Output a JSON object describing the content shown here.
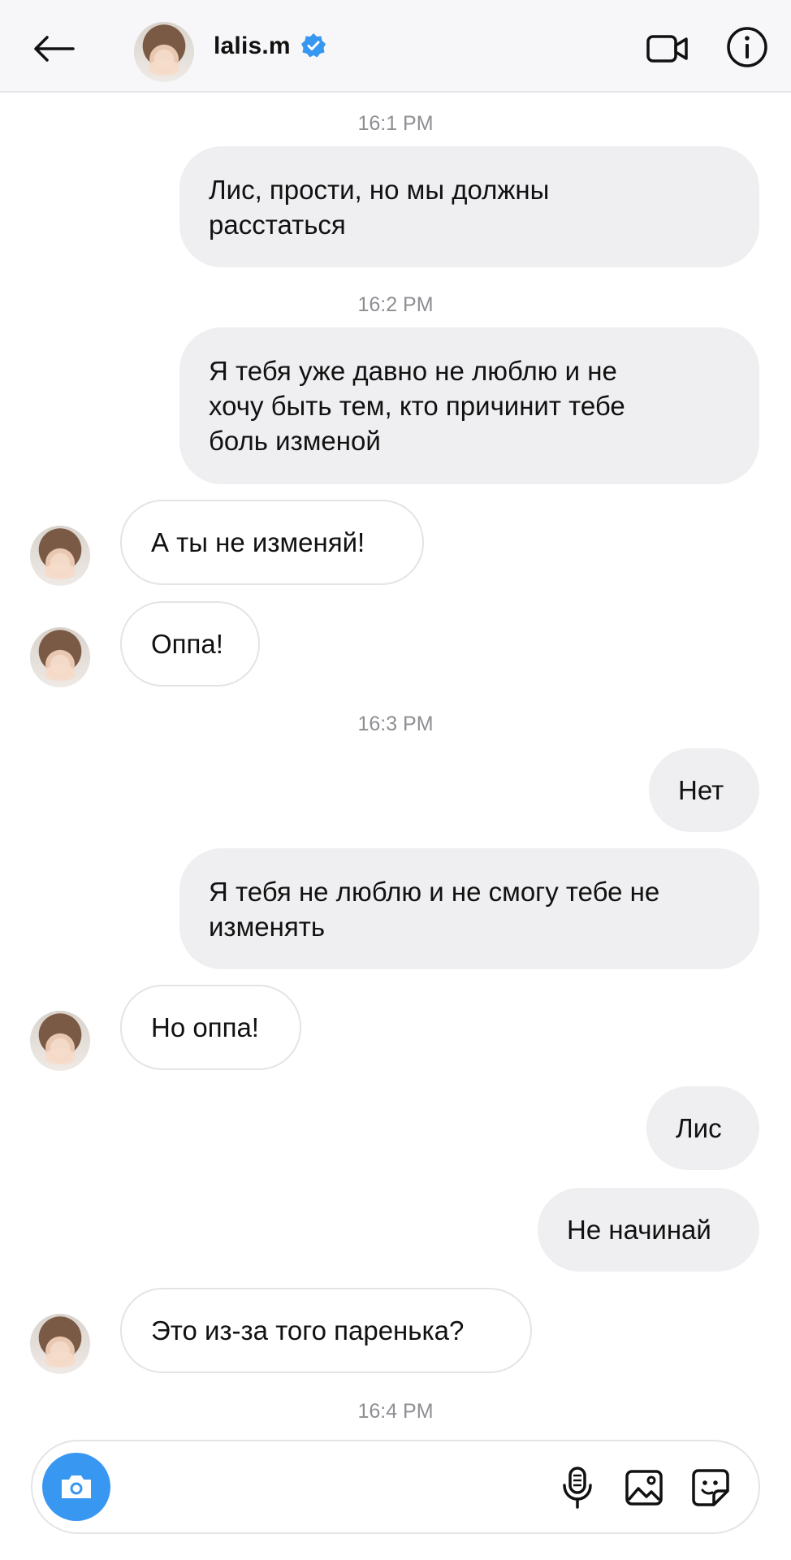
{
  "header": {
    "username": "lalis.m",
    "verified_color": "#3897f0"
  },
  "timestamps": [
    "16:1 PM",
    "16:2 PM",
    "16:3 PM",
    "16:4 PM"
  ],
  "messages": [
    {
      "direction": "out",
      "text": "Лис, прости, но мы должны\nрасстаться"
    },
    {
      "direction": "out",
      "text": "Я тебя уже давно не люблю и не\nхочу быть тем, кто причинит тебе\nболь изменой"
    },
    {
      "direction": "in",
      "text": "А ты не изменяй!"
    },
    {
      "direction": "in",
      "text": "Оппа!"
    },
    {
      "direction": "out",
      "text": "Нет"
    },
    {
      "direction": "out",
      "text": "Я тебя не люблю и не смогу тебе не\nизменять"
    },
    {
      "direction": "in",
      "text": "Но оппа!"
    },
    {
      "direction": "out",
      "text": "Лис"
    },
    {
      "direction": "out",
      "text": "Не начинай"
    },
    {
      "direction": "in",
      "text": "Это из-за того паренька?"
    }
  ],
  "composer": {
    "value": "",
    "placeholder": "",
    "camera_color": "#3897f0"
  },
  "icons": {
    "back": "back-arrow-icon",
    "video": "video-call-icon",
    "info": "info-icon",
    "camera": "camera-icon",
    "microphone": "microphone-icon",
    "gallery": "gallery-icon",
    "sticker": "sticker-icon"
  }
}
